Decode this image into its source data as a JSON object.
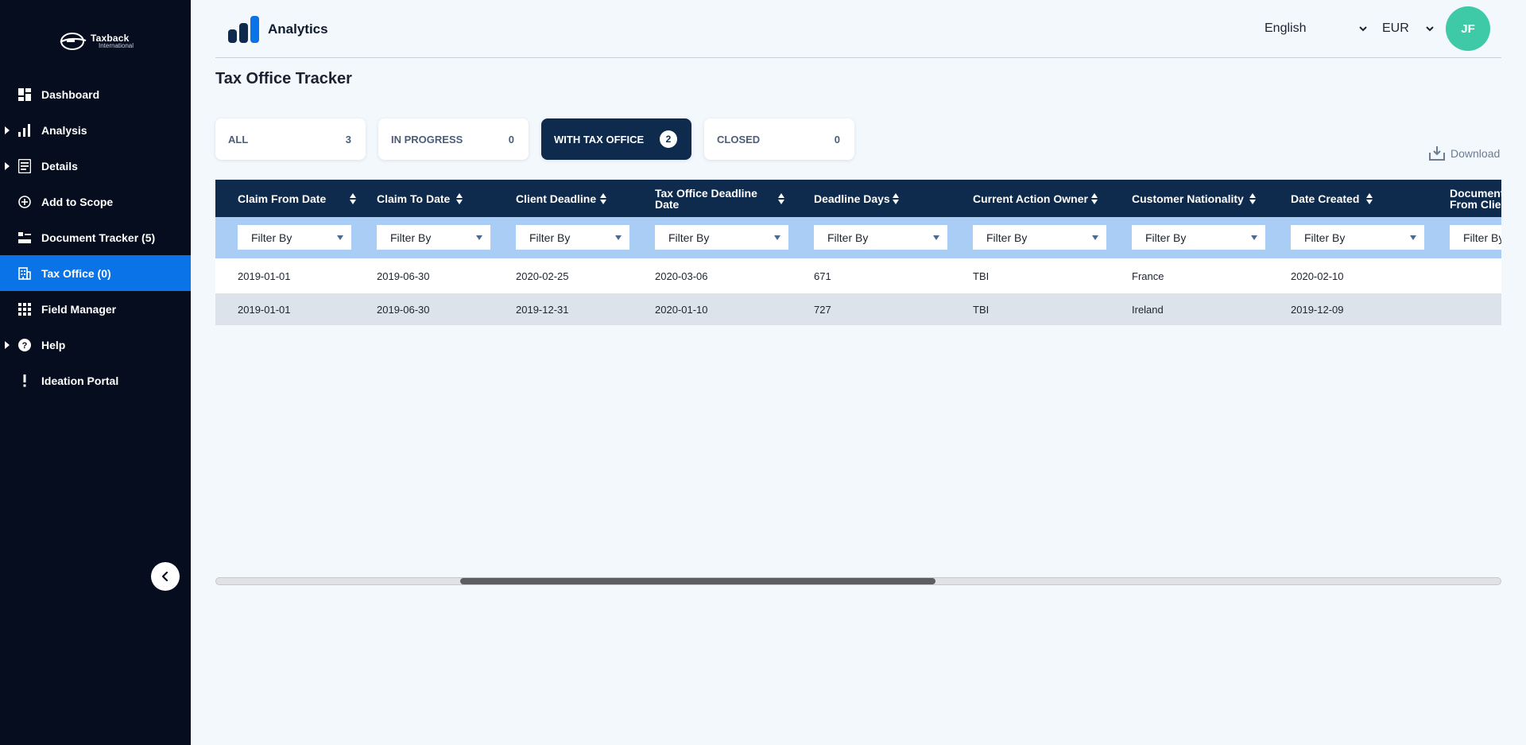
{
  "brand": {
    "logo_line1": "Taxback",
    "logo_line2": "International",
    "app_title": "Analytics"
  },
  "sidebar": {
    "items": [
      {
        "label": "Dashboard",
        "icon": "dashboard-icon",
        "expandable": false,
        "active": false
      },
      {
        "label": "Analysis",
        "icon": "bar-chart-icon",
        "expandable": true,
        "active": false
      },
      {
        "label": "Details",
        "icon": "list-icon",
        "expandable": true,
        "active": false
      },
      {
        "label": "Add to Scope",
        "icon": "plus-circle-icon",
        "expandable": false,
        "active": false
      },
      {
        "label": "Document Tracker (5)",
        "icon": "tracker-icon",
        "expandable": false,
        "active": false
      },
      {
        "label": "Tax Office (0)",
        "icon": "building-icon",
        "expandable": false,
        "active": true
      },
      {
        "label": "Field Manager",
        "icon": "grid-icon",
        "expandable": false,
        "active": false
      },
      {
        "label": "Help",
        "icon": "help-icon",
        "expandable": true,
        "active": false
      },
      {
        "label": "Ideation Portal",
        "icon": "exclamation-icon",
        "expandable": false,
        "active": false
      }
    ]
  },
  "header": {
    "language": "English",
    "currency": "EUR",
    "user_initials": "JF"
  },
  "page": {
    "title": "Tax Office Tracker",
    "download_label": "Download"
  },
  "status_cards": [
    {
      "label": "ALL",
      "count": "3",
      "active": false
    },
    {
      "label": "IN PROGRESS",
      "count": "0",
      "active": false
    },
    {
      "label": "WITH TAX OFFICE",
      "count": "2",
      "active": true
    },
    {
      "label": "CLOSED",
      "count": "0",
      "active": false
    }
  ],
  "table": {
    "filter_placeholder": "Filter By",
    "columns": [
      "Claim From Date",
      "Claim To Date",
      "Client Deadline",
      "Tax Office Deadline Date",
      "Deadline Days",
      "Current Action Owner",
      "Customer Nationality",
      "Date Created",
      "Documents From Client"
    ],
    "rows": [
      [
        "2019-01-01",
        "2019-06-30",
        "2020-02-25",
        "2020-03-06",
        "671",
        "TBI",
        "France",
        "2020-02-10",
        ""
      ],
      [
        "2019-01-01",
        "2019-06-30",
        "2019-12-31",
        "2020-01-10",
        "727",
        "TBI",
        "Ireland",
        "2019-12-09",
        ""
      ]
    ]
  },
  "colors": {
    "sidebar_bg": "#050d1f",
    "active_nav": "#0a73e8",
    "table_header": "#0e2a4d",
    "filter_row": "#a9cdf4",
    "avatar": "#3ec9a7"
  }
}
